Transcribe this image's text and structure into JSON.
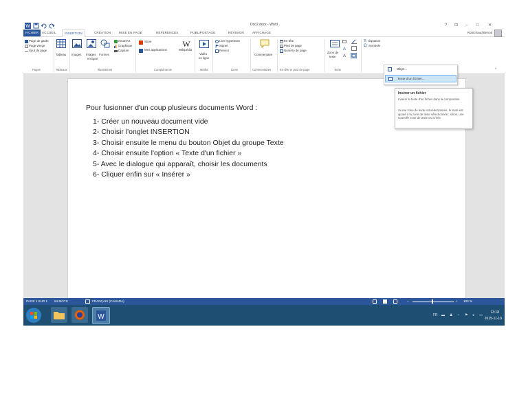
{
  "window": {
    "title": "Doc2.docx - Word"
  },
  "titlebar": {
    "help": "?",
    "restore": "⊡",
    "minimize": "–",
    "maximize": "□",
    "close": "✕"
  },
  "tabs": [
    "FICHIER",
    "ACCUEIL",
    "INSERTION",
    "CRÉATION",
    "MISE EN PAGE",
    "RÉFÉRENCES",
    "PUBLIPOSTAGE",
    "RÉVISION",
    "AFFICHAGE"
  ],
  "user": {
    "name": "Robichaud Benoit"
  },
  "ribbon": {
    "pages": {
      "cover": "Page de garde",
      "blank": "Page vierge",
      "break": "Saut de page",
      "group": "Pages"
    },
    "tables": {
      "table": "Tableau",
      "group": "Tableaux"
    },
    "illustrations": {
      "images": "Images",
      "online_1": "Images",
      "online_2": "en ligne",
      "shapes": "Formes",
      "smartart": "SmartArt",
      "chart": "Graphique",
      "capture": "Capture",
      "group": "Illustrations"
    },
    "addins": {
      "store": "Store",
      "myapps": "Mes applications",
      "wikipedia": "Wikipédia",
      "group": "Compléments"
    },
    "media": {
      "video_1": "Vidéo",
      "video_2": "en ligne",
      "group": "Média"
    },
    "links": {
      "hyperlink": "Lien hypertexte",
      "bookmark": "Signet",
      "crossref": "Renvoi",
      "group": "Liens"
    },
    "comments": {
      "comment": "Commentaire",
      "group": "Commentaires"
    },
    "headerfooter": {
      "header": "En-tête",
      "footer": "Pied de page",
      "pagenum": "Numéro de page",
      "group": "En-tête et pied de page"
    },
    "text": {
      "textbox_1": "Zone de",
      "textbox_2": "texte",
      "group": "Texte"
    },
    "symbols": {
      "equation": "Équation",
      "symbol": "Symbole"
    }
  },
  "dropdown": {
    "items": [
      "Objet...",
      "Texte d'un fichier..."
    ]
  },
  "tooltip": {
    "title": "Insérer un fichier",
    "line1": "Insérer le texte d'un fichier dans la composition.",
    "line2": "Si une zone de texte est sélectionnée, le texte est ajouté à la zone de texte sélectionnée ; sinon, une nouvelle zone de texte est créée."
  },
  "document": {
    "heading": "Pour fusionner d'un coup plusieurs documents Word :",
    "steps": [
      "1- Créer un nouveau document vide",
      "2- Choisir l'onglet INSERTION",
      "3- Choisir ensuite le menu du bouton Objet du groupe Texte",
      "4- Choisir ensuite l'option « Texte d'un fichier »",
      "5- Avec le dialogue qui apparaît, choisir les documents",
      "6- Cliquer enfin sur « Insérer »"
    ]
  },
  "status": {
    "page": "PAGE 1 SUR 1",
    "words": "54 MOTS",
    "language": "FRANÇAIS (CANADA)",
    "zoom": "100 %"
  },
  "clock": {
    "time": "13:18",
    "date": "2015-11-19"
  },
  "colors": {
    "word_blue": "#2b579a",
    "taskbar": "#1f4e73",
    "highlight": "#cde6f7"
  }
}
